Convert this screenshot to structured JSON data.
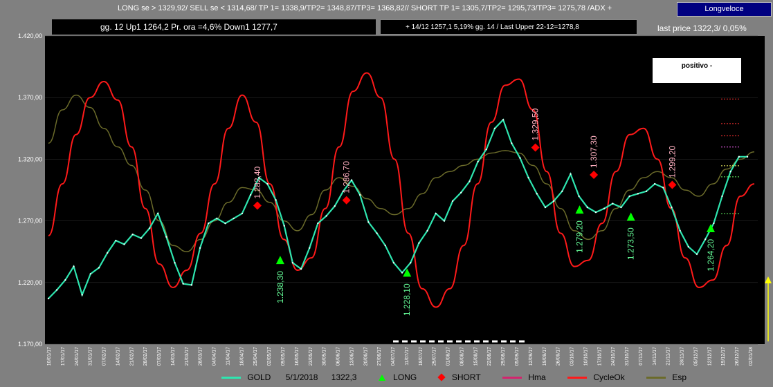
{
  "header": {
    "signals": "LONG se > 1329,92/  SELL se < 1314,68/ TP 1= 1338,9/TP2= 1348,87/TP3= 1368,82//   SHORT TP 1= 1305,7/TP2= 1295,73/TP3= 1275,78 /ADX +",
    "mode": "Longveloce",
    "info_left": "gg. 12 Up1   1264,2   Pr. ora =4,6%    Down1  1277,7",
    "info_mid": "+  14/12    1257,1  5,19%   gg. 14 / Last Upper 22-12=1278,8",
    "last_price": "last price  1322,3/  0,05%",
    "status": "positivo  -"
  },
  "colors": {
    "gold": "#2ee6b0",
    "cycle": "#ff1a1a",
    "hma": "#d4246e",
    "esp": "#6b6b2a",
    "long": "#00ff00",
    "short": "#ff0000",
    "label": "#ffb0c0",
    "label_long": "#66ff99"
  },
  "legend": [
    {
      "label": "GOLD",
      "extra": "5/1/2018",
      "value": "1322,3",
      "kind": "line",
      "color": "#2ee6b0"
    },
    {
      "label": "LONG",
      "kind": "triangle"
    },
    {
      "label": "SHORT",
      "kind": "diamond"
    },
    {
      "label": "Hma",
      "kind": "line",
      "color": "#d4246e"
    },
    {
      "label": "CycleOk",
      "kind": "line",
      "color": "#ff1a1a"
    },
    {
      "label": "Esp",
      "kind": "line",
      "color": "#6b6b2a"
    }
  ],
  "chart_data": {
    "type": "line",
    "ylim": [
      1170,
      1420
    ],
    "yticks": [
      "1.170,00",
      "1.220,00",
      "1.270,00",
      "1.320,00",
      "1.370,00",
      "1.420,00"
    ],
    "x_labels": [
      "10/01/17",
      "17/01/17",
      "24/01/17",
      "31/01/17",
      "07/02/17",
      "14/02/17",
      "21/02/17",
      "28/02/17",
      "07/03/17",
      "14/03/17",
      "21/03/17",
      "28/03/17",
      "04/04/17",
      "11/04/17",
      "18/04/17",
      "25/04/17",
      "02/05/17",
      "09/05/17",
      "16/05/17",
      "23/05/17",
      "30/05/17",
      "06/06/17",
      "13/06/17",
      "20/06/17",
      "27/06/17",
      "04/07/17",
      "11/07/17",
      "18/07/17",
      "25/07/17",
      "01/08/17",
      "08/08/17",
      "15/08/17",
      "22/08/17",
      "29/08/17",
      "05/09/17",
      "12/09/17",
      "19/09/17",
      "26/09/17",
      "03/10/17",
      "10/10/17",
      "17/10/17",
      "24/10/17",
      "31/10/17",
      "07/11/17",
      "14/11/17",
      "21/11/17",
      "28/11/17",
      "05/12/17",
      "12/12/17",
      "19/12/17",
      "26/12/17",
      "02/01/18"
    ],
    "series": [
      {
        "name": "GOLD",
        "values": [
          1207,
          1214,
          1222,
          1233,
          1210,
          1227,
          1232,
          1244,
          1254,
          1251,
          1259,
          1256,
          1264,
          1276,
          1257,
          1236,
          1219,
          1218,
          1248,
          1268,
          1272,
          1268,
          1272,
          1276,
          1291,
          1305,
          1300,
          1287,
          1266,
          1236,
          1231,
          1248,
          1268,
          1274,
          1282,
          1294,
          1303,
          1291,
          1269,
          1260,
          1250,
          1236,
          1228,
          1236,
          1252,
          1262,
          1276,
          1270,
          1286,
          1293,
          1302,
          1318,
          1328,
          1345,
          1352,
          1333,
          1321,
          1305,
          1292,
          1281,
          1286,
          1294,
          1308,
          1290,
          1281,
          1277,
          1280,
          1284,
          1281,
          1290,
          1292,
          1294,
          1300,
          1297,
          1281,
          1262,
          1249,
          1243,
          1255,
          1268,
          1290,
          1310,
          1322,
          1322
        ]
      },
      {
        "name": "CycleOk",
        "values": [
          1258,
          1300,
          1340,
          1370,
          1383,
          1368,
          1330,
          1280,
          1235,
          1216,
          1230,
          1260,
          1300,
          1345,
          1372,
          1350,
          1300,
          1255,
          1230,
          1240,
          1280,
          1330,
          1375,
          1390,
          1370,
          1320,
          1260,
          1215,
          1200,
          1215,
          1250,
          1300,
          1350,
          1380,
          1385,
          1360,
          1310,
          1260,
          1233,
          1238,
          1268,
          1310,
          1340,
          1345,
          1320,
          1280,
          1240,
          1216,
          1222,
          1250,
          1290,
          1300
        ]
      },
      {
        "name": "Esp",
        "values": [
          1333,
          1360,
          1372,
          1362,
          1345,
          1330,
          1315,
          1295,
          1270,
          1250,
          1245,
          1255,
          1270,
          1285,
          1297,
          1295,
          1285,
          1270,
          1262,
          1275,
          1295,
          1305,
          1298,
          1288,
          1280,
          1275,
          1280,
          1292,
          1305,
          1310,
          1315,
          1320,
          1325,
          1327,
          1325,
          1315,
          1300,
          1280,
          1262,
          1255,
          1262,
          1280,
          1295,
          1305,
          1310,
          1305,
          1295,
          1290,
          1300,
          1312,
          1320,
          1326
        ]
      }
    ],
    "long_signals": [
      {
        "x": 0.33,
        "y": 1238.3,
        "label": "1.238,30"
      },
      {
        "x": 0.508,
        "y": 1228.1,
        "label": "1.228,10"
      },
      {
        "x": 0.75,
        "y": 1279.2,
        "label": "1.279,20"
      },
      {
        "x": 0.822,
        "y": 1273.5,
        "label": "1.273,50"
      },
      {
        "x": 0.934,
        "y": 1264.2,
        "label": "1.264,20"
      }
    ],
    "short_signals": [
      {
        "x": 0.298,
        "y": 1282.4,
        "label": "1.282,40"
      },
      {
        "x": 0.423,
        "y": 1286.7,
        "label": "1.286,70"
      },
      {
        "x": 0.688,
        "y": 1329.5,
        "label": "1.329,50"
      },
      {
        "x": 0.77,
        "y": 1307.3,
        "label": "1.307,30"
      },
      {
        "x": 0.88,
        "y": 1299.2,
        "label": "1.299,20"
      }
    ]
  }
}
